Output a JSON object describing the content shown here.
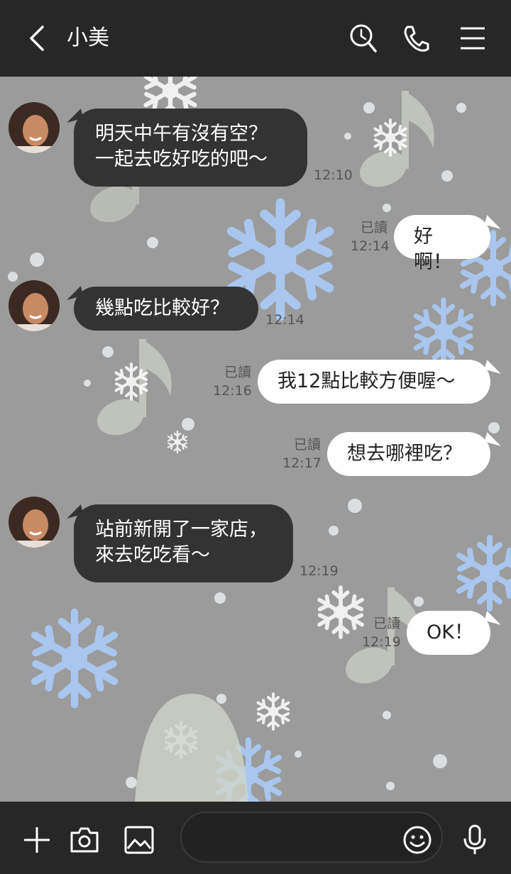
{
  "header": {
    "back_icon": "chevron-left-icon",
    "title": "小美",
    "icons": [
      "search-clock-icon",
      "phone-icon",
      "menu-icon"
    ]
  },
  "messages": [
    {
      "side": "left",
      "text": "明天中午有沒有空？\n一起去吃好吃的吧～",
      "time": "12:10"
    },
    {
      "side": "right",
      "text": "好啊！",
      "read": "已讀",
      "time": "12:14"
    },
    {
      "side": "left",
      "text": "幾點吃比較好？",
      "time": "12:14"
    },
    {
      "side": "right",
      "text": "我12點比較方便喔～",
      "read": "已讀",
      "time": "12:16"
    },
    {
      "side": "right",
      "text": "想去哪裡吃？",
      "read": "已讀",
      "time": "12:17"
    },
    {
      "side": "left",
      "text": "站前新開了一家店，\n來去吃吃看～",
      "time": "12:19"
    },
    {
      "side": "right",
      "text": "OK！",
      "read": "已讀",
      "time": "12:19"
    }
  ],
  "input_bar": {
    "icons": [
      "plus-icon",
      "camera-icon",
      "image-icon",
      "emoji-icon",
      "microphone-icon"
    ],
    "placeholder": ""
  },
  "colors": {
    "header": "#272727",
    "background": "#9b9b9b",
    "left_bubble": "#333333",
    "right_bubble": "#ffffff",
    "snowflake": "#a9c6ee"
  }
}
